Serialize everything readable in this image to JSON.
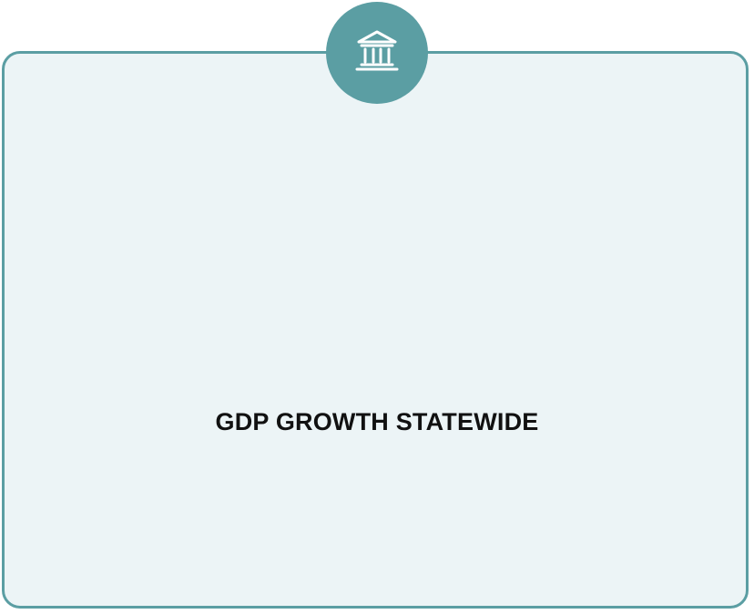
{
  "card": {
    "title": "GDP GROWTH STATEWIDE",
    "icon": "bank-building-icon"
  },
  "colors": {
    "accent": "#5b9ea3",
    "card_background": "#ecf4f6",
    "title_text": "#111111",
    "icon_glyph": "#ffffff"
  }
}
